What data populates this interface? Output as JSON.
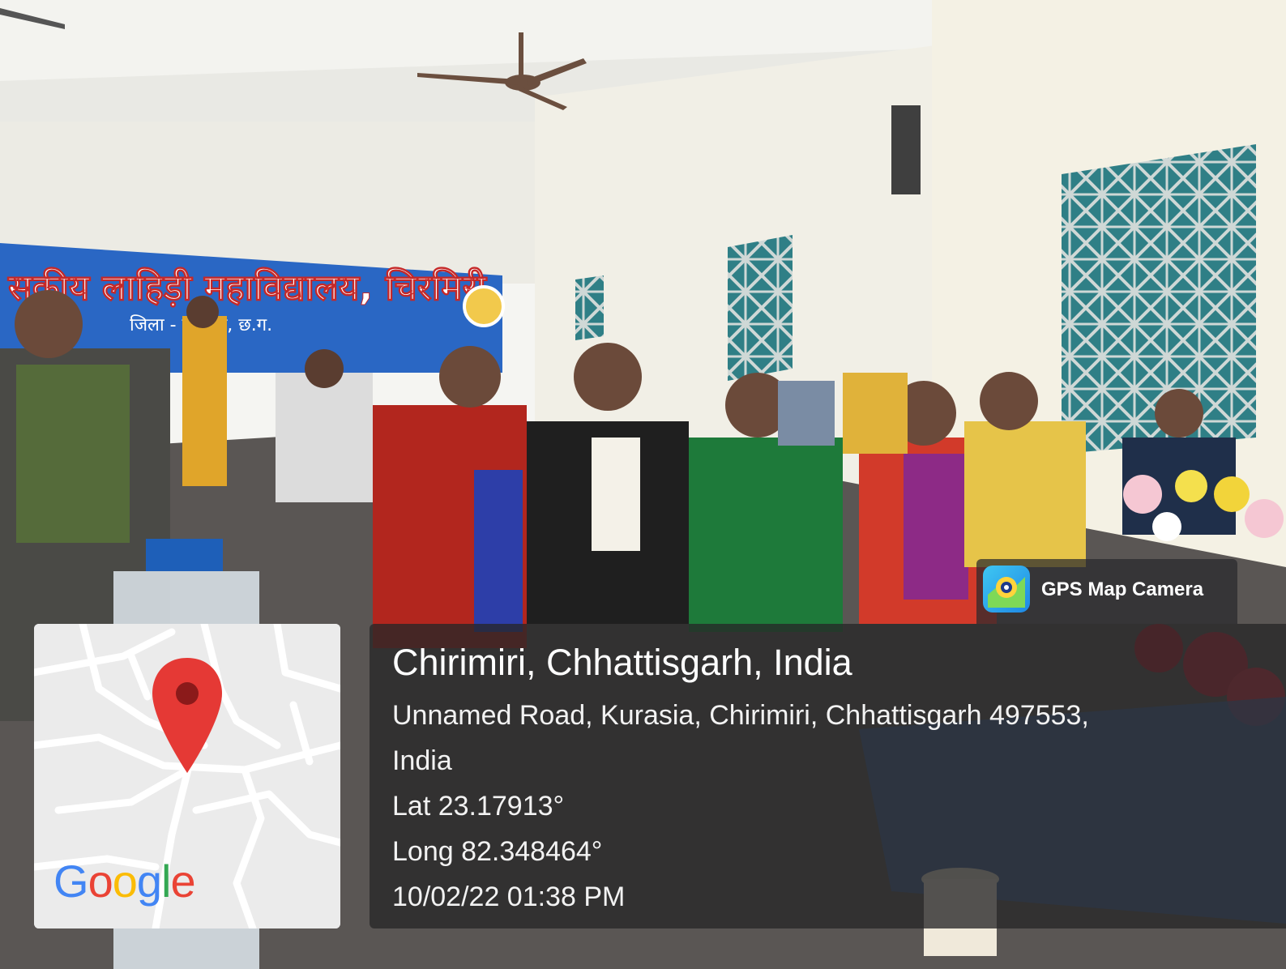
{
  "photo": {
    "banner_text": "सकीय लाहिड़ी महाविद्यालय, चिरमिरी",
    "banner_subtext": "जिला - कोरिया, छ.ग."
  },
  "badge": {
    "label": "GPS Map Camera",
    "icon": "gps-map-camera-icon"
  },
  "map": {
    "logo_text": "Google",
    "logo_colors": [
      "#4285F4",
      "#EA4335",
      "#FBBC05",
      "#4285F4",
      "#34A853",
      "#EA4335"
    ],
    "pin_icon": "map-pin-icon",
    "pin_color": "#E53935"
  },
  "location": {
    "title": "Chirimiri, Chhattisgarh, India",
    "address_line1": "Unnamed Road, Kurasia, Chirimiri, Chhattisgarh 497553,",
    "address_line2": "India",
    "latitude": "Lat 23.17913°",
    "longitude": "Long 82.348464°",
    "datetime": "10/02/22 01:38 PM"
  }
}
